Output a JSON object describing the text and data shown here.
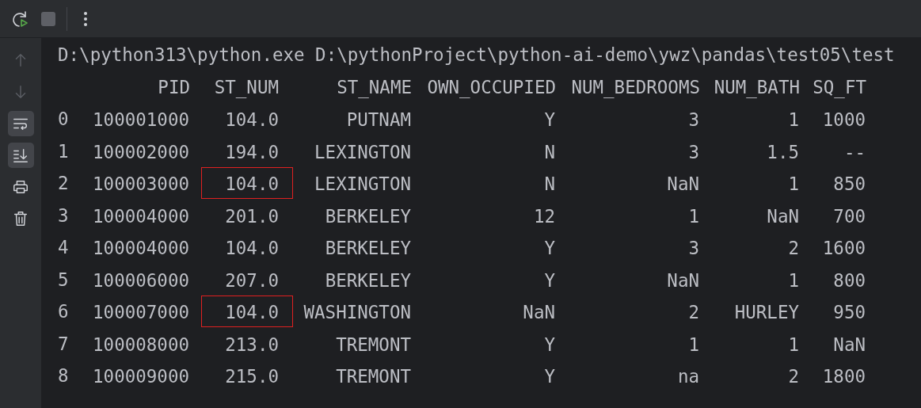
{
  "toolbar": {
    "rerun": {
      "disabled": false
    },
    "stop": {
      "disabled": true
    }
  },
  "side_tools": [
    {
      "selected": false,
      "disabled": true
    },
    {
      "selected": false,
      "disabled": true
    },
    {
      "selected": true,
      "disabled": false
    },
    {
      "selected": true,
      "disabled": false
    },
    {
      "selected": false,
      "disabled": false
    },
    {
      "selected": false,
      "disabled": false
    }
  ],
  "console": {
    "command": "D:\\python313\\python.exe D:\\pythonProject\\python-ai-demo\\ywz\\pandas\\test05\\test",
    "columns": [
      "PID",
      "ST_NUM",
      "ST_NAME",
      "OWN_OCCUPIED",
      "NUM_BEDROOMS",
      "NUM_BATH",
      "SQ_FT"
    ],
    "rows": [
      {
        "index": "0",
        "cells": [
          {
            "text": "100001000",
            "boxed": false
          },
          {
            "text": "104.0",
            "boxed": false
          },
          {
            "text": "PUTNAM",
            "boxed": false
          },
          {
            "text": "Y",
            "boxed": false
          },
          {
            "text": "3",
            "boxed": false
          },
          {
            "text": "1",
            "boxed": false
          },
          {
            "text": "1000",
            "boxed": false
          }
        ]
      },
      {
        "index": "1",
        "cells": [
          {
            "text": "100002000",
            "boxed": false
          },
          {
            "text": "194.0",
            "boxed": false
          },
          {
            "text": "LEXINGTON",
            "boxed": false
          },
          {
            "text": "N",
            "boxed": false
          },
          {
            "text": "3",
            "boxed": false
          },
          {
            "text": "1.5",
            "boxed": false
          },
          {
            "text": "--",
            "boxed": false
          }
        ]
      },
      {
        "index": "2",
        "cells": [
          {
            "text": "100003000",
            "boxed": false
          },
          {
            "text": "104.0",
            "boxed": true
          },
          {
            "text": "LEXINGTON",
            "boxed": false
          },
          {
            "text": "N",
            "boxed": false
          },
          {
            "text": "NaN",
            "boxed": false
          },
          {
            "text": "1",
            "boxed": false
          },
          {
            "text": "850",
            "boxed": false
          }
        ]
      },
      {
        "index": "3",
        "cells": [
          {
            "text": "100004000",
            "boxed": false
          },
          {
            "text": "201.0",
            "boxed": false
          },
          {
            "text": "BERKELEY",
            "boxed": false
          },
          {
            "text": "12",
            "boxed": false
          },
          {
            "text": "1",
            "boxed": false
          },
          {
            "text": "NaN",
            "boxed": false
          },
          {
            "text": "700",
            "boxed": false
          }
        ]
      },
      {
        "index": "4",
        "cells": [
          {
            "text": "100004000",
            "boxed": false
          },
          {
            "text": "104.0",
            "boxed": false
          },
          {
            "text": "BERKELEY",
            "boxed": false
          },
          {
            "text": "Y",
            "boxed": false
          },
          {
            "text": "3",
            "boxed": false
          },
          {
            "text": "2",
            "boxed": false
          },
          {
            "text": "1600",
            "boxed": false
          }
        ]
      },
      {
        "index": "5",
        "cells": [
          {
            "text": "100006000",
            "boxed": false
          },
          {
            "text": "207.0",
            "boxed": false
          },
          {
            "text": "BERKELEY",
            "boxed": false
          },
          {
            "text": "Y",
            "boxed": false
          },
          {
            "text": "NaN",
            "boxed": false
          },
          {
            "text": "1",
            "boxed": false
          },
          {
            "text": "800",
            "boxed": false
          }
        ]
      },
      {
        "index": "6",
        "cells": [
          {
            "text": "100007000",
            "boxed": false
          },
          {
            "text": "104.0",
            "boxed": true
          },
          {
            "text": "WASHINGTON",
            "boxed": false
          },
          {
            "text": "NaN",
            "boxed": false
          },
          {
            "text": "2",
            "boxed": false
          },
          {
            "text": "HURLEY",
            "boxed": false
          },
          {
            "text": "950",
            "boxed": false
          }
        ]
      },
      {
        "index": "7",
        "cells": [
          {
            "text": "100008000",
            "boxed": false
          },
          {
            "text": "213.0",
            "boxed": false
          },
          {
            "text": "TREMONT",
            "boxed": false
          },
          {
            "text": "Y",
            "boxed": false
          },
          {
            "text": "1",
            "boxed": false
          },
          {
            "text": "1",
            "boxed": false
          },
          {
            "text": "NaN",
            "boxed": false
          }
        ]
      },
      {
        "index": "8",
        "cells": [
          {
            "text": "100009000",
            "boxed": false
          },
          {
            "text": "215.0",
            "boxed": false
          },
          {
            "text": "TREMONT",
            "boxed": false
          },
          {
            "text": "Y",
            "boxed": false
          },
          {
            "text": "na",
            "boxed": false
          },
          {
            "text": "2",
            "boxed": false
          },
          {
            "text": "1800",
            "boxed": false
          }
        ]
      }
    ]
  }
}
